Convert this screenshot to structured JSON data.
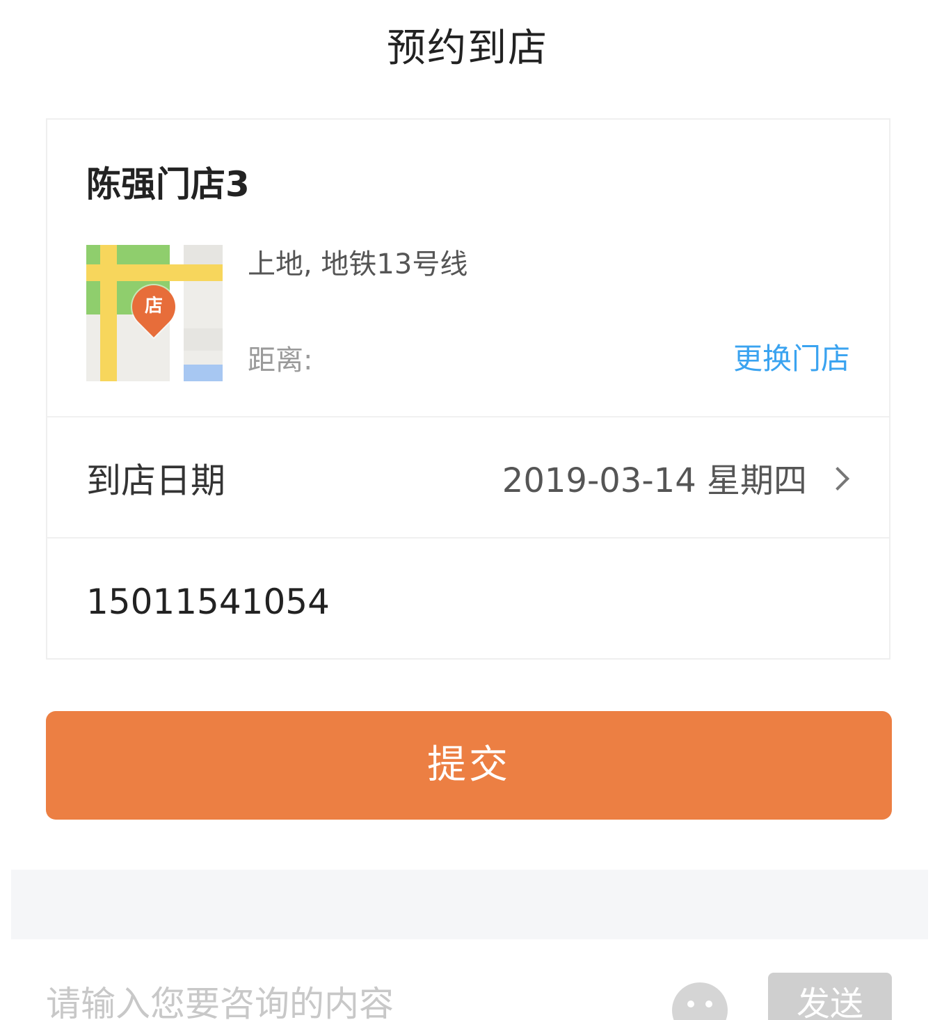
{
  "header": {
    "title": "预约到店"
  },
  "store": {
    "name": "陈强门店3",
    "map_pin_label": "店",
    "address": "上地, 地铁13号线",
    "distance_label": "距离:",
    "change_store_label": "更换门店"
  },
  "visit_date": {
    "label": "到店日期",
    "value": "2019-03-14 星期四"
  },
  "phone": {
    "value": "15011541054"
  },
  "submit": {
    "label": "提交"
  },
  "chat": {
    "placeholder": "请输入您要咨询的内容",
    "send_label": "发送"
  },
  "colors": {
    "accent": "#ec7f43",
    "link": "#3aa3f0",
    "disabled_button": "#cfcfcf"
  },
  "icons": {
    "map_pin": "map-pin-icon",
    "chevron": "chevron-right-icon",
    "emoji": "emoji-icon"
  }
}
